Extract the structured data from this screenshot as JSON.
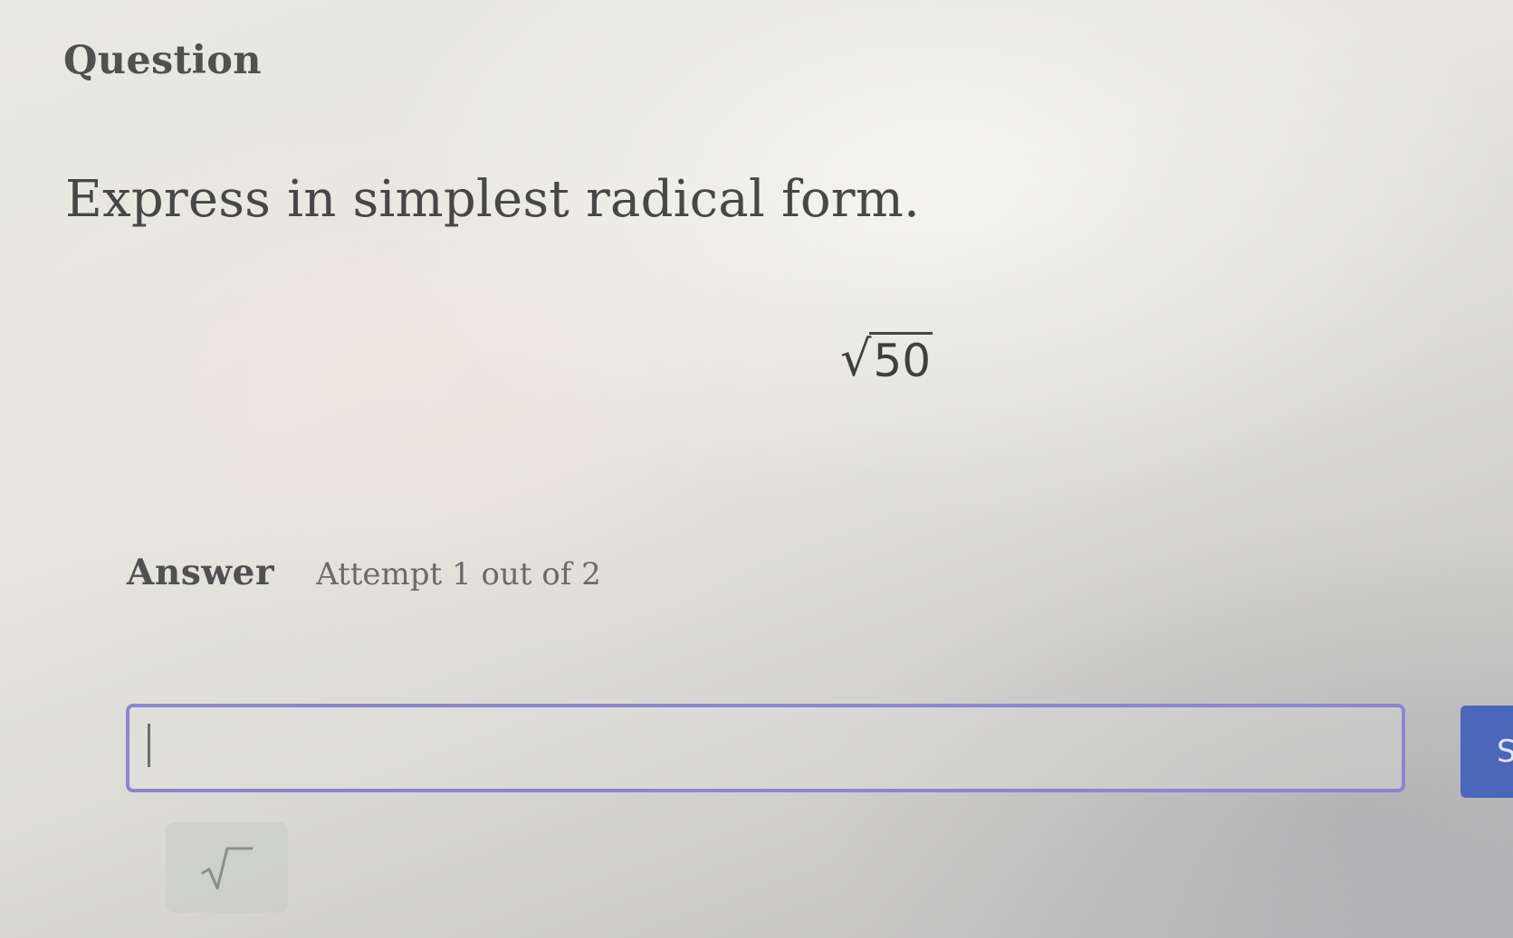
{
  "question": {
    "heading": "Question",
    "prompt": "Express in simplest radical form.",
    "expression": {
      "radical_symbol": "√",
      "radicand": "50"
    }
  },
  "answer": {
    "label": "Answer",
    "attempt": "Attempt 1 out of 2",
    "input_value": "",
    "submit_label": "S"
  },
  "toolbar": {
    "sqrt_tool_icon": "square-root-icon"
  },
  "colors": {
    "input_border": "#8c86d1",
    "submit_button": "#4b67b9"
  }
}
